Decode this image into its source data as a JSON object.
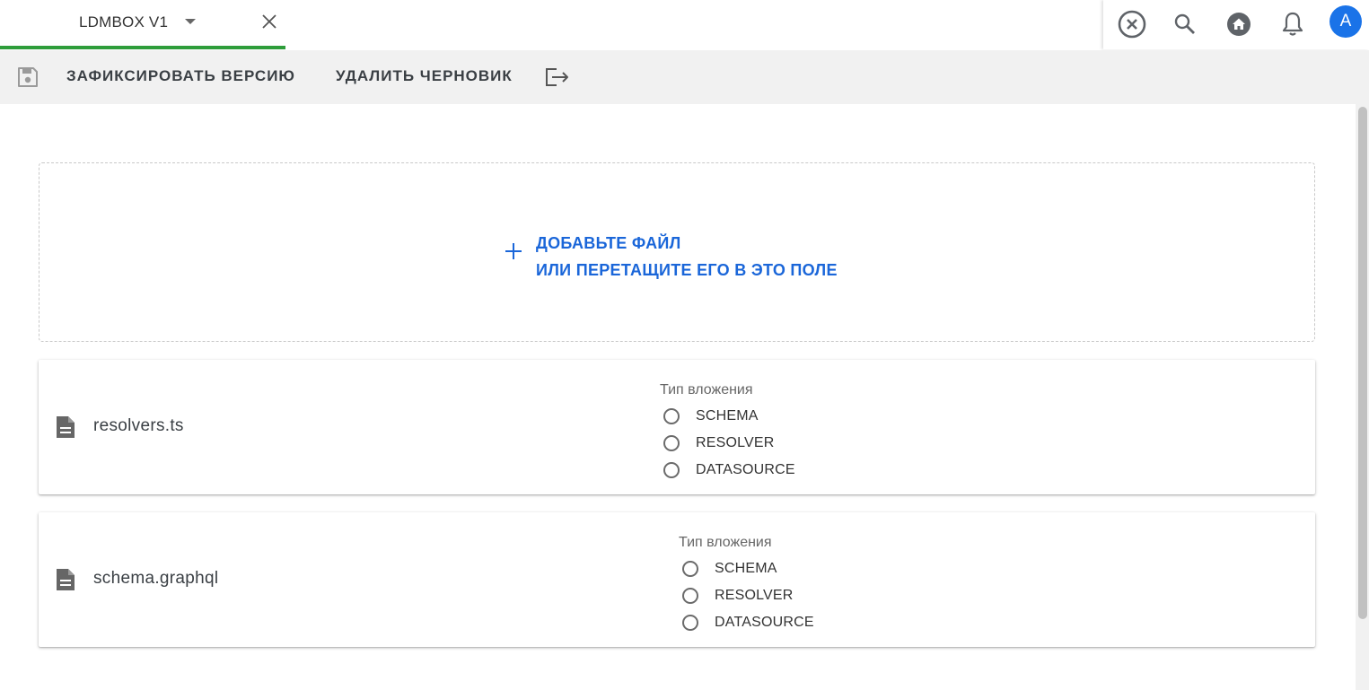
{
  "tab": {
    "title": "LDMBOX V1"
  },
  "header": {
    "avatar_letter": "A"
  },
  "toolbar": {
    "commit_label": "ЗАФИКСИРОВАТЬ ВЕРСИЮ",
    "delete_draft_label": "УДАЛИТЬ ЧЕРНОВИК"
  },
  "dropzone": {
    "line1": "ДОБАВЬТЕ ФАЙЛ",
    "line2": "ИЛИ ПЕРЕТАЩИТЕ ЕГО В ЭТО ПОЛЕ"
  },
  "files": [
    {
      "name": "resolvers.ts",
      "attachment_type_label": "Тип вложения",
      "options": [
        "SCHEMA",
        "RESOLVER",
        "DATASOURCE"
      ]
    },
    {
      "name": "schema.graphql",
      "attachment_type_label": "Тип вложения",
      "options": [
        "SCHEMA",
        "RESOLVER",
        "DATASOURCE"
      ]
    }
  ],
  "colors": {
    "tab_underline": "#2e9d3a",
    "accent_blue": "#1a66d9",
    "avatar_bg": "#1a73e8",
    "toolbar_bg": "#f1f1f1"
  },
  "icons": {
    "tab": [
      "caret-down-icon",
      "close-icon"
    ],
    "header": [
      "cancel-circle-icon",
      "search-icon",
      "home-icon",
      "bell-icon"
    ],
    "toolbar": [
      "save-icon",
      "exit-icon"
    ],
    "dropzone": "plus-icon",
    "file": "document-icon"
  }
}
